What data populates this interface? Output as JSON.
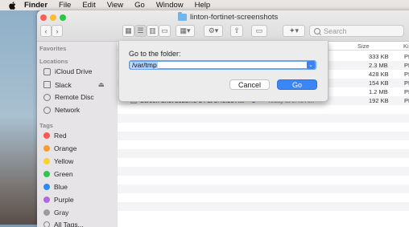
{
  "menubar": {
    "app": "Finder",
    "items": [
      "File",
      "Edit",
      "View",
      "Go",
      "Window",
      "Help"
    ]
  },
  "window": {
    "title": "linton-fortinet-screenshots",
    "search_placeholder": "Search"
  },
  "sidebar": {
    "favorites_header": "Favorites",
    "locations_header": "Locations",
    "locations": [
      "iCloud Drive",
      "Slack",
      "Remote Disc",
      "Network"
    ],
    "tags_header": "Tags",
    "tags": [
      {
        "label": "Red",
        "color": "#fc5753"
      },
      {
        "label": "Orange",
        "color": "#fd9a30"
      },
      {
        "label": "Yellow",
        "color": "#f9d22d"
      },
      {
        "label": "Green",
        "color": "#2fc84f"
      },
      {
        "label": "Blue",
        "color": "#2b8cf7"
      },
      {
        "label": "Purple",
        "color": "#b467e0"
      },
      {
        "label": "Gray",
        "color": "#9c9ca0"
      }
    ],
    "all_tags": "All Tags..."
  },
  "list": {
    "size_header": "Size",
    "kind_header": "Ki",
    "rows": [
      {
        "size": "333 KB",
        "kind": "PN"
      },
      {
        "size": "2.3 MB",
        "kind": "PN"
      },
      {
        "size": "428 KB",
        "kind": "PN"
      },
      {
        "size": "154 KB",
        "kind": "PN"
      },
      {
        "size": "1.2 MB",
        "kind": "PN"
      },
      {
        "name": "Screen Shot 2023...5-24 at 9.43.28 AM",
        "date": "Today at 9:43 AM",
        "size": "192 KB",
        "kind": "PN"
      }
    ]
  },
  "dialog": {
    "label": "Go to the folder:",
    "value": "/var/tmp",
    "cancel_label": "Cancel",
    "go_label": "Go"
  }
}
